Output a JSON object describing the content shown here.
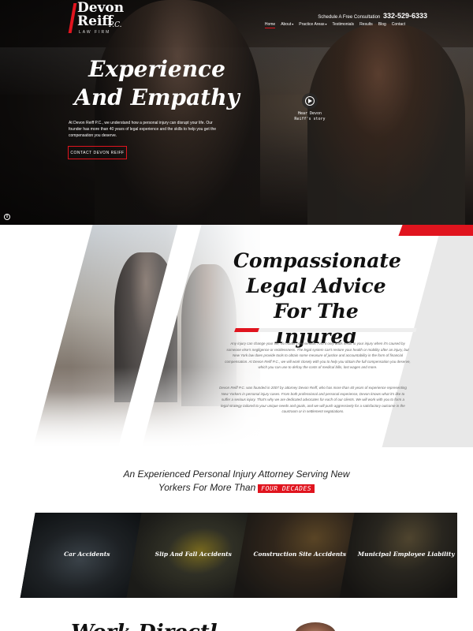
{
  "brand": {
    "line1": "Devon",
    "line2": "Reiff",
    "suffix": "P.C.",
    "tagline": "LAW FIRM",
    "accent_color": "#e0141e"
  },
  "header": {
    "consult_label": "Schedule A Free Consultation",
    "phone": "332-529-6333"
  },
  "nav": {
    "items": [
      {
        "label": "Home",
        "active": true
      },
      {
        "label": "About",
        "has_dropdown": true
      },
      {
        "label": "Practice Areas",
        "has_dropdown": true
      },
      {
        "label": "Testimonials"
      },
      {
        "label": "Results"
      },
      {
        "label": "Blog"
      },
      {
        "label": "Contact"
      }
    ],
    "caret": "▾"
  },
  "hero": {
    "title": "Experience And Empathy",
    "blurb": "At Devon Reiff P.C., we understand how a personal injury can disrupt your life. Our founder has more than 40 years of legal experience and the skills to help you get the compensation you deserve.",
    "cta_label": "CONTACT DEVON REIFF",
    "video_label_1": "Hear Devon",
    "video_label_2": "Reiff's story",
    "pause_icon": "II"
  },
  "about": {
    "title": "Compassionate Legal Advice For The Injured",
    "para1": "Any injury can change your life, no matter how serious. And it only adds insult to your injury when it's caused by someone else's negligence or recklessness. The legal system can't restore your health or mobility after an injury, but New York law does provide tools to obtain some measure of justice and accountability in the form of financial compensation. At Devon Reiff P.C., we will work closely with you to help you obtain the full compensation you deserve, which you can use to defray the costs of medical bills, lost wages and more.",
    "para2": "Devon Reiff P.C. was founded in 2007 by attorney Devon Reiff, who has more than 40 years of experience representing New Yorkers in personal injury cases. From both professional and personal experience, Devon knows what it's like to suffer a serious injury. That's why we are dedicated advocates for each of our clients. We will work with you to form a legal strategy tailored to your unique needs and goals, and we will push aggressively for a satisfactory outcome in the courtroom or in settlement negotiations."
  },
  "practice": {
    "heading_line1": "An Experienced Personal Injury Attorney Serving New",
    "heading_line2": "Yorkers For More Than",
    "badge": "FOUR DECADES",
    "tiles": [
      {
        "label": "Car Accidents"
      },
      {
        "label": "Slip And Fall Accidents"
      },
      {
        "label": "Construction Site Accidents"
      },
      {
        "label": "Municipal Employee Liability"
      }
    ]
  },
  "next_section": {
    "heading_partial": "Work Directl"
  }
}
